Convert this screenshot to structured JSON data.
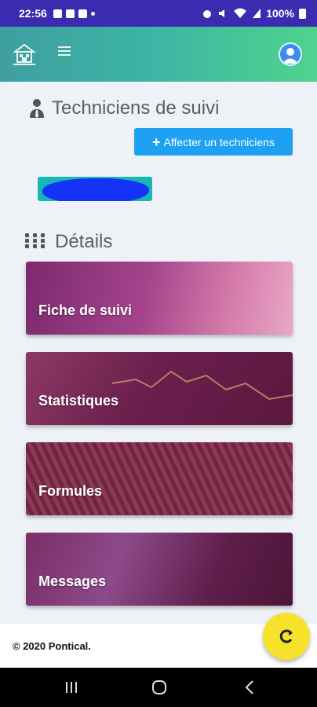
{
  "status_bar": {
    "time": "22:56",
    "battery": "100%"
  },
  "header": {
    "logo_icon": "building-logo-icon",
    "menu_icon": "hamburger-icon",
    "avatar_icon": "user-avatar-icon"
  },
  "techniciens": {
    "title": "Techniciens de suivi",
    "icon": "user-tie-icon",
    "add_button_label": "Affecter un techniciens",
    "add_button_icon": "plus-icon"
  },
  "details": {
    "title": "Détails",
    "icon": "grid-dots-icon",
    "cards": [
      {
        "label": "Fiche de suivi"
      },
      {
        "label": "Statistiques"
      },
      {
        "label": "Formules"
      },
      {
        "label": "Messages"
      }
    ]
  },
  "footer": {
    "copyright": "© 2020 Pontical."
  },
  "fab": {
    "icon": "refresh-icon"
  },
  "colors": {
    "status_bar": "#3b2bb0",
    "accent": "#1ea1f2",
    "chip": "#17b8b3",
    "fab": "#f6e22a"
  }
}
